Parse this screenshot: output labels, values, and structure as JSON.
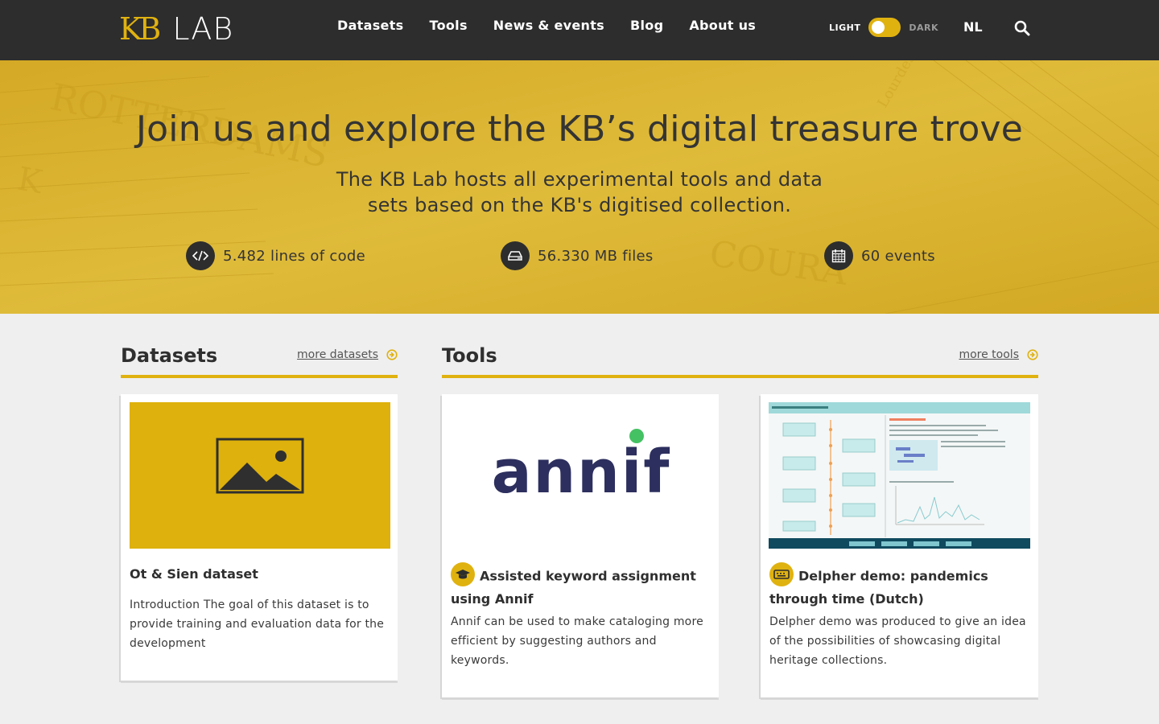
{
  "brand": {
    "kb": "KB",
    "lab": "LAB"
  },
  "nav": {
    "items": [
      "Datasets",
      "Tools",
      "News & events",
      "Blog",
      "About us"
    ],
    "theme_light": "LIGHT",
    "theme_dark": "DARK",
    "language": "NL"
  },
  "hero": {
    "title": "Join us and explore the KB’s digital treasure trove",
    "subtitle": "The KB Lab hosts all experimental tools and data sets based on the KB's digitised collection.",
    "stats": [
      {
        "icon": "code-icon",
        "label": "5.482 lines of code"
      },
      {
        "icon": "hard-drive-icon",
        "label": "56.330 MB files"
      },
      {
        "icon": "calendar-icon",
        "label": "60 events"
      }
    ]
  },
  "datasets": {
    "heading": "Datasets",
    "more": "more datasets",
    "cards": [
      {
        "title": "Ot & Sien dataset",
        "description": "Introduction The goal of this dataset is to provide training and evaluation data for the development"
      }
    ]
  },
  "tools": {
    "heading": "Tools",
    "more": "more tools",
    "cards": [
      {
        "title": "Assisted keyword assignment using Annif",
        "description": "Annif can be used to make cataloging more efficient by suggesting authors and keywords.",
        "logo_text": "annif"
      },
      {
        "title": "Delpher demo: pandemics through time (Dutch)",
        "description": "Delpher demo was produced to give an idea of the possibilities of showcasing digital heritage collections."
      }
    ]
  },
  "colors": {
    "accent": "#e0b210",
    "nav_bg": "#2d2d2d",
    "page_bg": "#efefef"
  }
}
